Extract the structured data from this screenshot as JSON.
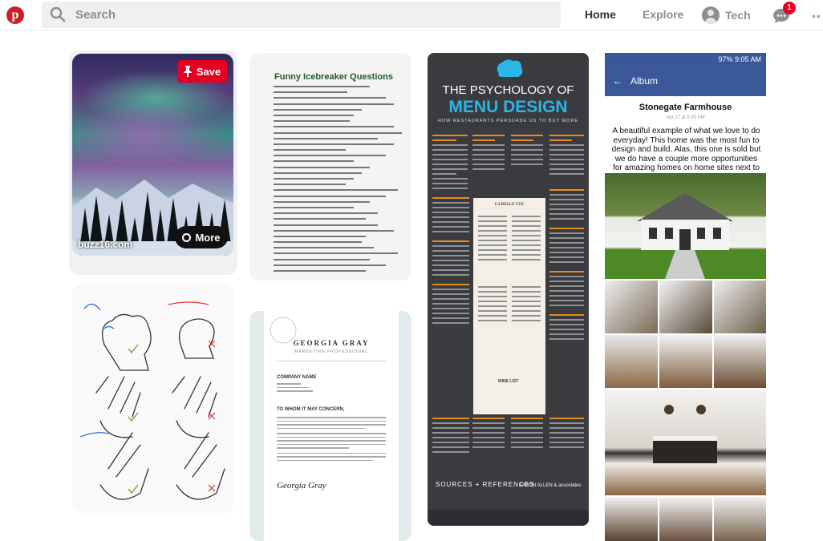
{
  "topbar": {
    "logo_letter": "p",
    "search_placeholder": "Search",
    "nav_home": "Home",
    "nav_explore": "Explore",
    "profile_name": "Tech",
    "notification_count": "1",
    "more_dots": "••"
  },
  "pins": {
    "aurora": {
      "save_label": "Save",
      "source": "buzz16.com",
      "more_label": "More"
    },
    "icebreaker": {
      "title": "Funny Icebreaker Questions"
    },
    "resume": {
      "name": "GEORGIA GRAY",
      "subtitle": "MARKETING PROFESSIONAL",
      "company_heading": "COMPANY NAME",
      "salutation": "TO WHOM IT MAY CONCERN,",
      "signature": "Georgia Gray"
    },
    "menu": {
      "title_line1": "THE PSYCHOLOGY OF",
      "title_line2": "MENU DESIGN",
      "tagline": "HOW RESTAURANTS PERSUADE US TO BUY MORE",
      "card_title": "LA BELLE VUE",
      "wine_list": "WINE LIST",
      "sources": "SOURCES + REFERENCES",
      "brand": "AARON ALLEN & associates"
    },
    "album": {
      "status_text": "97% 9:05 AM",
      "header_label": "Album",
      "title": "Stonegate Farmhouse",
      "date": "Apr 27 at 5:30 PM",
      "description": "A beautiful example of what we love to do everyday! This home was the most fun to design and build. Alas, this one is sold but we do have a couple more opportunities for amazing homes on home sites next to this one!"
    }
  }
}
